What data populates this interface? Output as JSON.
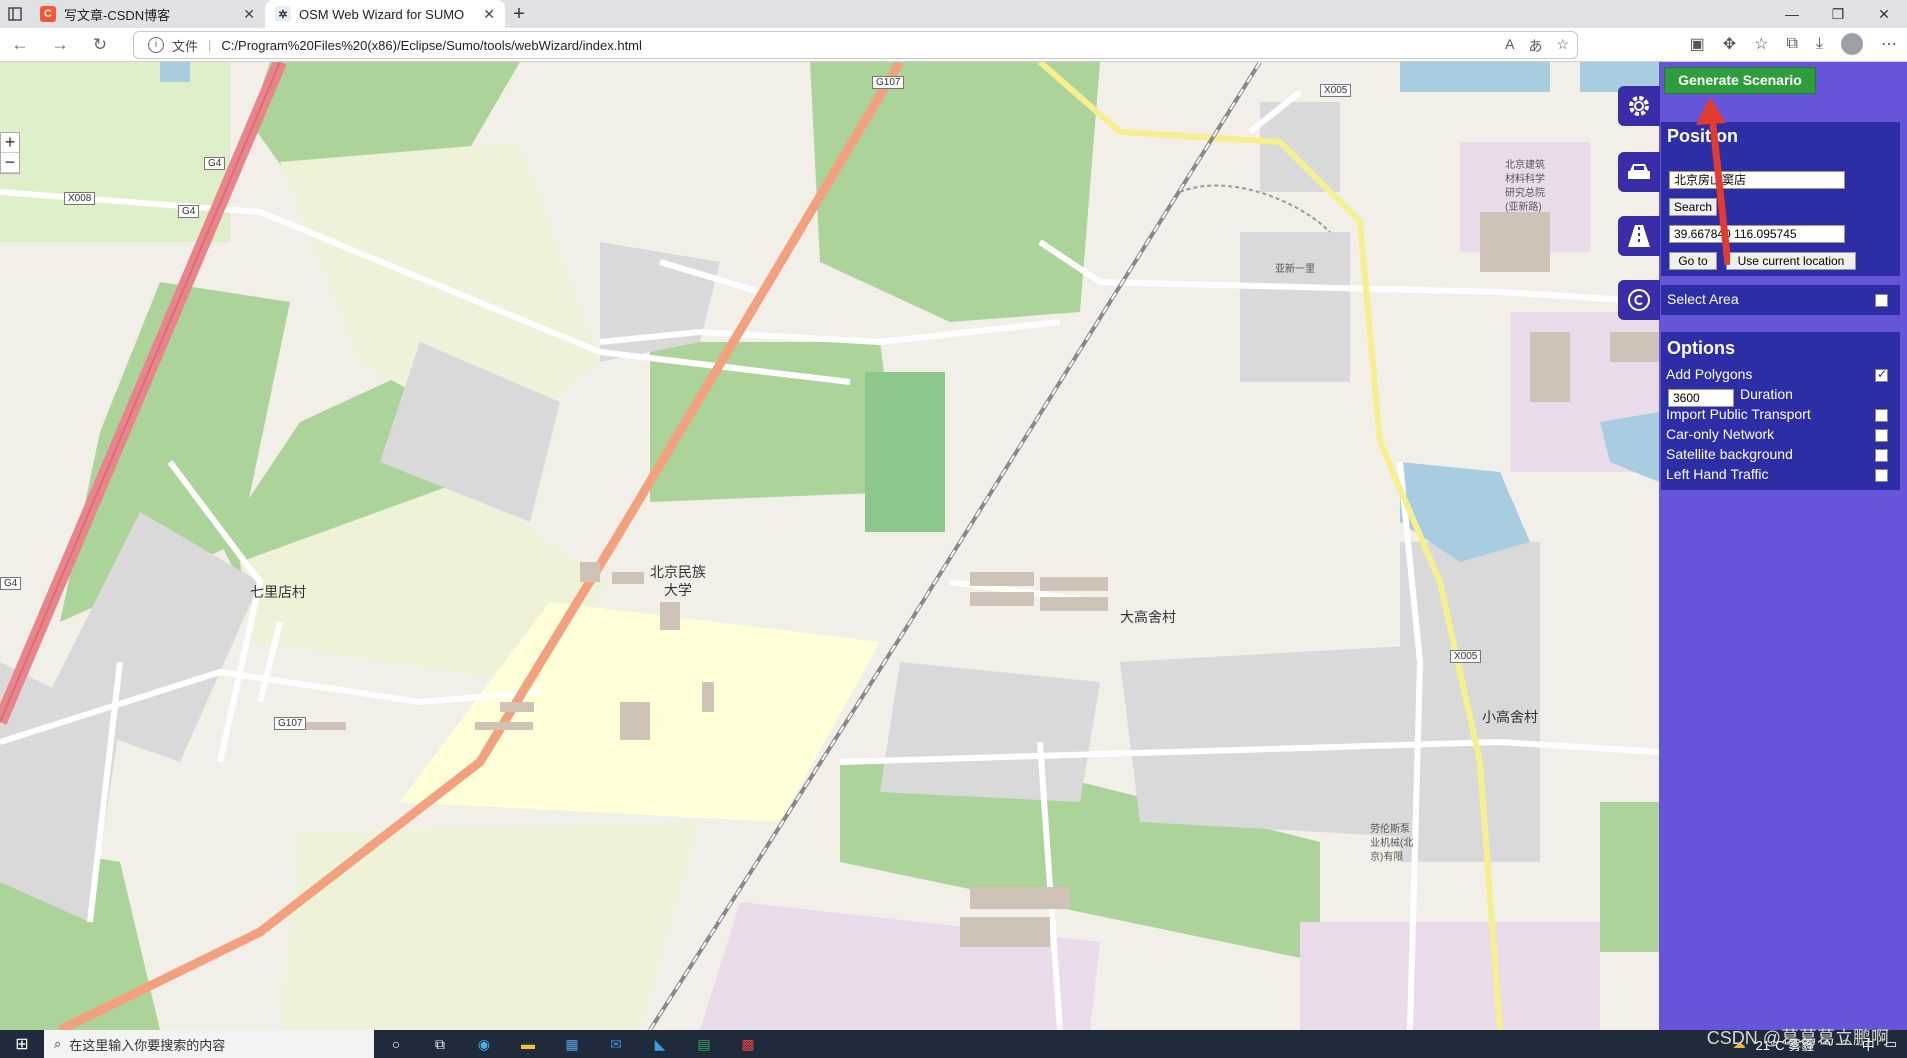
{
  "browser": {
    "tabs": [
      {
        "label": "写文章-CSDN博客",
        "active": false
      },
      {
        "label": "OSM Web Wizard for SUMO",
        "active": true
      }
    ],
    "address": {
      "file_label": "文件",
      "url": "C:/Program%20Files%20(x86)/Eclipse/Sumo/tools/webWizard/index.html"
    },
    "window_buttons": [
      "—",
      "❐",
      "✕"
    ]
  },
  "map": {
    "labels": [
      {
        "text": "北京民族"
      },
      {
        "text": "大学"
      },
      {
        "text": "七里店村"
      },
      {
        "text": "大高舍村"
      },
      {
        "text": "小高舍村"
      },
      {
        "text": "亚新一里"
      }
    ],
    "small_labels": [
      {
        "text": "北京建筑"
      },
      {
        "text": "材料科学"
      },
      {
        "text": "研究总院"
      },
      {
        "text": "(亚新路)"
      },
      {
        "text": "劳伦斯泵"
      },
      {
        "text": "业机械(北"
      },
      {
        "text": "京)有限"
      }
    ],
    "shields": [
      {
        "text": "G107"
      },
      {
        "text": "X005"
      },
      {
        "text": "X008"
      },
      {
        "text": "G4"
      },
      {
        "text": "G4"
      },
      {
        "text": "G4"
      },
      {
        "text": "X005"
      },
      {
        "text": "G107"
      }
    ],
    "zoom_in": "+",
    "zoom_out": "−"
  },
  "panel": {
    "generate_label": "Generate Scenario",
    "position": {
      "title": "Position",
      "search_value": "北京房山窦店",
      "search_button": "Search",
      "coords_value": "39.667840 116.095745",
      "goto_button": "Go to",
      "current_button": "Use current location"
    },
    "select_area": {
      "label": "Select Area",
      "checked": false
    },
    "options": {
      "title": "Options",
      "add_polygons": {
        "label": "Add Polygons",
        "checked": true
      },
      "duration_value": "3600",
      "duration_label": "Duration",
      "public_transport": {
        "label": "Import Public Transport",
        "checked": false
      },
      "car_only": {
        "label": "Car-only Network",
        "checked": false
      },
      "satellite": {
        "label": "Satellite background",
        "checked": false
      },
      "left_hand": {
        "label": "Left Hand Traffic",
        "checked": false
      }
    }
  },
  "taskbar": {
    "search_placeholder": "在这里输入你要搜索的内容",
    "weather": "21°C 雾霾",
    "ime": "中",
    "watermark": "CSDN @葛葛葛立鹏啊"
  },
  "colors": {
    "panel_bg": "#6755d9",
    "box_bg": "#2d2ea5",
    "generate_bg": "#2f9d3e",
    "arrow": "#e33b2f"
  }
}
